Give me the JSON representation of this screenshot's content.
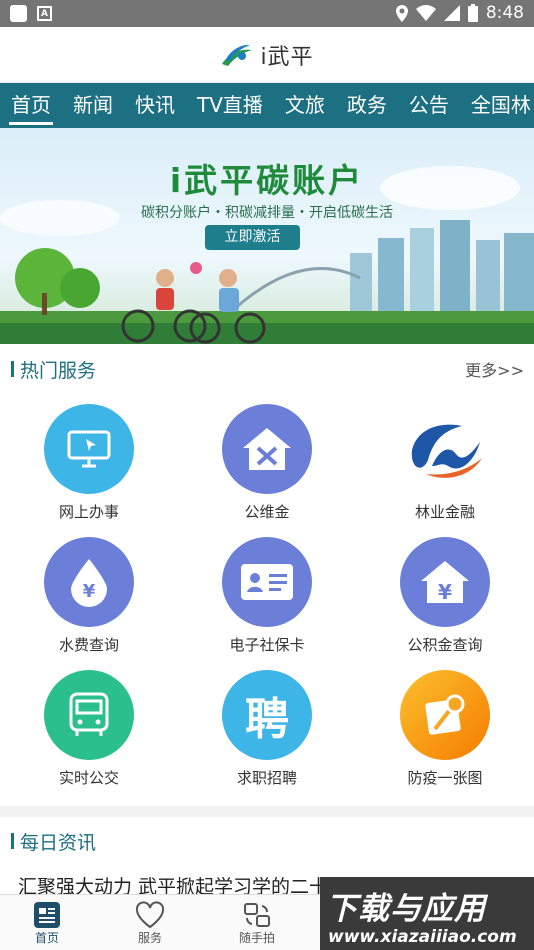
{
  "status_bar": {
    "time": "8:48",
    "notification_icon": "A"
  },
  "header": {
    "brand": "i武平"
  },
  "tabs": [
    "首页",
    "新闻",
    "快讯",
    "TV直播",
    "文旅",
    "政务",
    "公告",
    "全国林"
  ],
  "banner": {
    "title": "i武平碳账户",
    "subtitle": "碳积分账户・积碳减排量・开启低碳生活",
    "button": "立即激活"
  },
  "hot_services": {
    "title": "热门服务",
    "more": "更多>>",
    "items": [
      {
        "label": "网上办事",
        "icon": "monitor-icon",
        "color": "#3db5e6"
      },
      {
        "label": "公维金",
        "icon": "house-tools-icon",
        "color": "#6c7fd8"
      },
      {
        "label": "林业金融",
        "icon": "forestry-logo-icon",
        "color": "#ffffff"
      },
      {
        "label": "水费查询",
        "icon": "water-drop-yen-icon",
        "color": "#6c7fd8"
      },
      {
        "label": "电子社保卡",
        "icon": "id-card-icon",
        "color": "#6c7fd8"
      },
      {
        "label": "公积金查询",
        "icon": "house-yen-icon",
        "color": "#6c7fd8"
      },
      {
        "label": "实时公交",
        "icon": "bus-icon",
        "color": "#2bbf8e"
      },
      {
        "label": "求职招聘",
        "icon": "recruit-icon",
        "color": "#3db5e6",
        "glyph": "聘"
      },
      {
        "label": "防疫一张图",
        "icon": "map-pin-icon",
        "color": "#f5a623"
      }
    ]
  },
  "daily_news": {
    "title": "每日资讯",
    "headline": "汇聚强大动力 武平掀起学习学的二十大精神热潮"
  },
  "bottom_nav": [
    {
      "label": "首页",
      "icon": "home-icon"
    },
    {
      "label": "服务",
      "icon": "heart-icon"
    },
    {
      "label": "随手拍",
      "icon": "camera-rotate-icon"
    }
  ],
  "watermark": {
    "title": "下载与应用",
    "url": "www.xiazaiiiao.com"
  }
}
